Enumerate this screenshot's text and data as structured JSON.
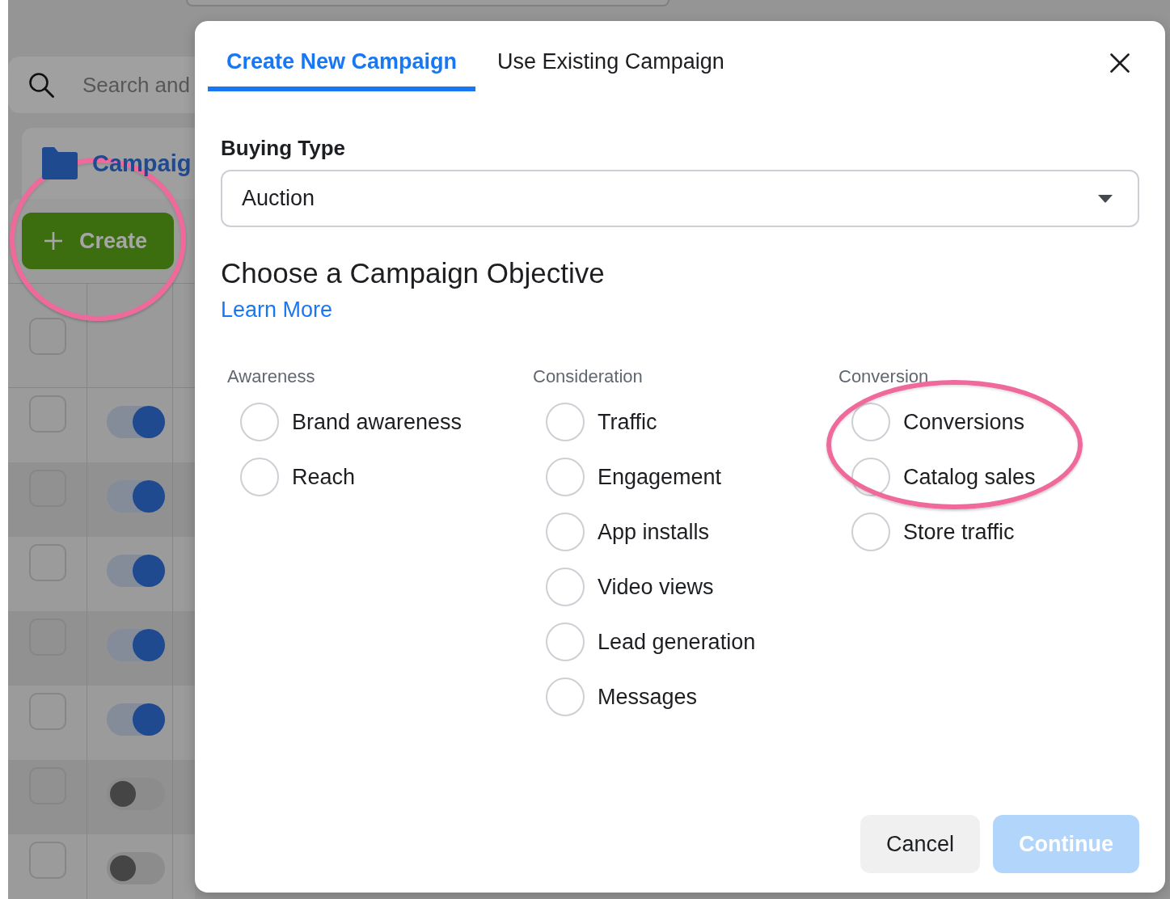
{
  "background": {
    "search": {
      "placeholder": "Search and"
    },
    "tab": {
      "label": "Campaig"
    },
    "create_button": {
      "label": "Create",
      "circled": true
    },
    "table": {
      "header": {
        "checked": false
      },
      "rows": [
        {
          "checked": false,
          "on": true
        },
        {
          "checked": false,
          "on": true
        },
        {
          "checked": false,
          "on": true
        },
        {
          "checked": false,
          "on": true
        },
        {
          "checked": false,
          "on": true
        },
        {
          "checked": false,
          "on": false
        },
        {
          "checked": false,
          "on": false
        }
      ]
    }
  },
  "dialog": {
    "tabs": [
      {
        "label": "Create New Campaign",
        "selected": true
      },
      {
        "label": "Use Existing Campaign",
        "selected": false
      }
    ],
    "buying_type": {
      "label": "Buying Type",
      "value": "Auction"
    },
    "objective": {
      "title": "Choose a Campaign Objective",
      "link": "Learn More",
      "groups": [
        {
          "heading": "Awareness",
          "options": [
            {
              "label": "Brand awareness",
              "selected": false,
              "circled": false
            },
            {
              "label": "Reach",
              "selected": false,
              "circled": false
            }
          ]
        },
        {
          "heading": "Consideration",
          "options": [
            {
              "label": "Traffic",
              "selected": false,
              "circled": false
            },
            {
              "label": "Engagement",
              "selected": false,
              "circled": false
            },
            {
              "label": "App installs",
              "selected": false,
              "circled": false
            },
            {
              "label": "Video views",
              "selected": false,
              "circled": false
            },
            {
              "label": "Lead generation",
              "selected": false,
              "circled": false
            },
            {
              "label": "Messages",
              "selected": false,
              "circled": false
            }
          ]
        },
        {
          "heading": "Conversion",
          "options": [
            {
              "label": "Conversions",
              "selected": false,
              "circled": true
            },
            {
              "label": "Catalog sales",
              "selected": false,
              "circled": true
            },
            {
              "label": "Store traffic",
              "selected": false,
              "circled": false
            }
          ]
        }
      ]
    },
    "buttons": [
      {
        "label": "Cancel",
        "kind": "secondary",
        "disabled": false
      },
      {
        "label": "Continue",
        "kind": "primary",
        "disabled": true
      }
    ]
  }
}
